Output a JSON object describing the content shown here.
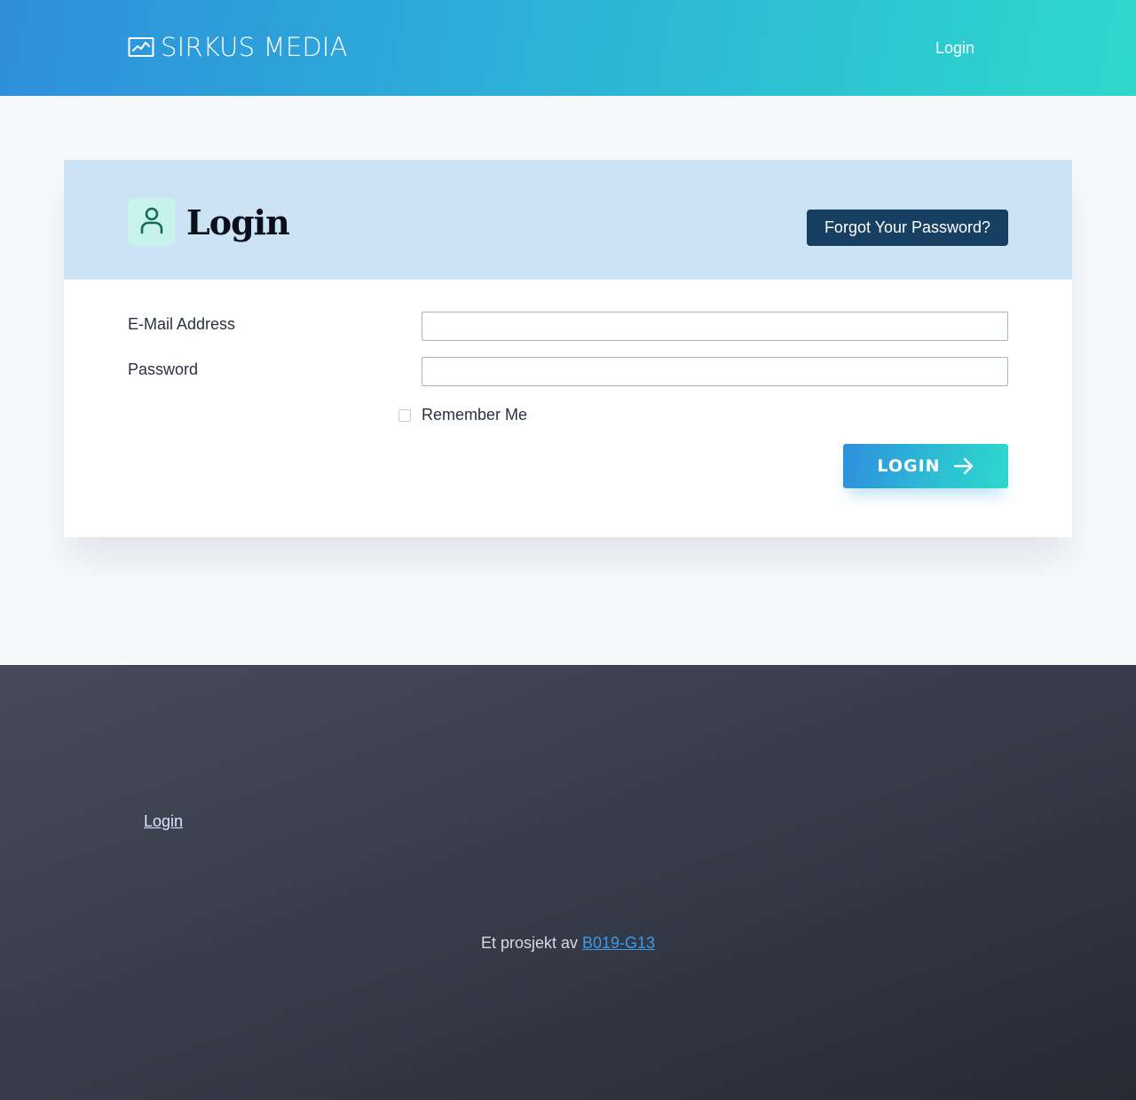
{
  "header": {
    "brand": "SIRKUS MEDIA",
    "brand_icon": "chart-line-icon",
    "nav_login": "Login"
  },
  "card": {
    "title": "Login",
    "title_icon": "user-icon",
    "forgot_password": "Forgot Your Password?",
    "email_label": "E-Mail Address",
    "email_value": "",
    "password_label": "Password",
    "password_value": "",
    "remember_label": "Remember Me",
    "remember_checked": false,
    "submit_label": "LOGIN",
    "submit_icon": "arrow-right-icon"
  },
  "footer": {
    "login_link": "Login",
    "credit_prefix": "Et prosjekt av ",
    "credit_link": "B019-G13"
  },
  "colors": {
    "header_gradient_start": "#2e8fdd",
    "header_gradient_end": "#2ed8cc",
    "card_head_bg": "#cce3f5",
    "forgot_button_bg": "#163f61",
    "footer_bg": "#3a3f4d",
    "link_blue": "#3b9bea"
  }
}
